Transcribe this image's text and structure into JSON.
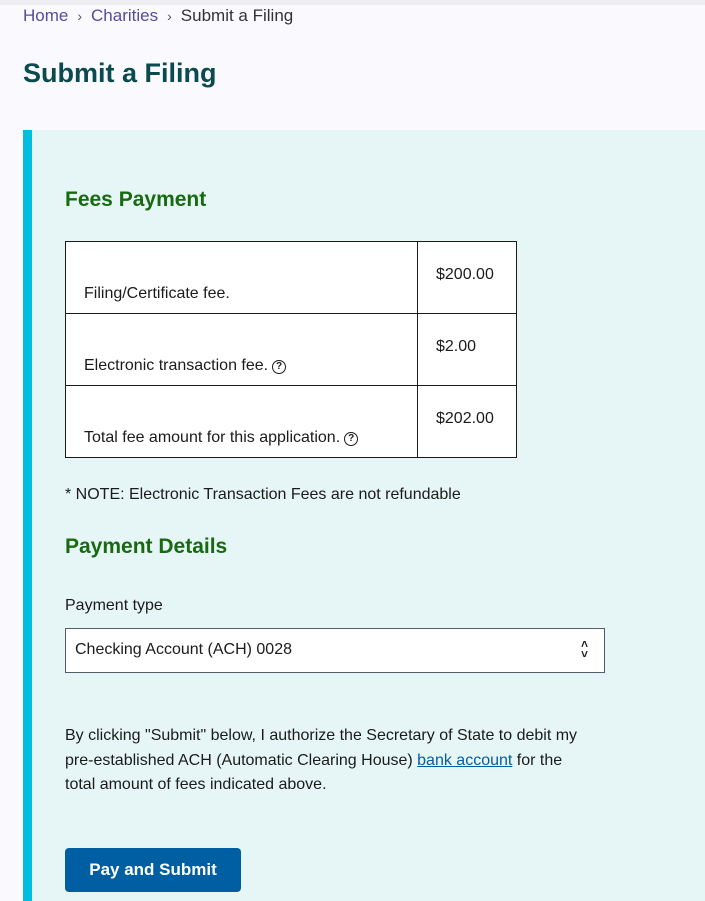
{
  "breadcrumb": {
    "items": [
      "Home",
      "Charities"
    ],
    "current": "Submit a Filing"
  },
  "page_title": "Submit a Filing",
  "fees": {
    "heading": "Fees Payment",
    "rows": [
      {
        "label": "Filing/Certificate fee.",
        "amount": "$200.00",
        "help": false
      },
      {
        "label": "Electronic transaction fee.",
        "amount": "$2.00",
        "help": true
      },
      {
        "label": "Total fee amount for this application.",
        "amount": "$202.00",
        "help": true
      }
    ],
    "note": "* NOTE: Electronic Transaction Fees are not refundable"
  },
  "payment": {
    "heading": "Payment Details",
    "type_label": "Payment type",
    "type_value": "Checking Account (ACH) 0028",
    "auth_before": "By clicking \"Submit\" below, I authorize the Secretary of State to debit my pre-established ACH (Automatic Clearing House) ",
    "auth_link": "bank account",
    "auth_after": " for the total amount of fees indicated above.",
    "submit_label": "Pay and Submit"
  },
  "colors": {
    "accent_border": "#00bde3",
    "heading_green": "#176a10",
    "button": "#005ea2"
  }
}
